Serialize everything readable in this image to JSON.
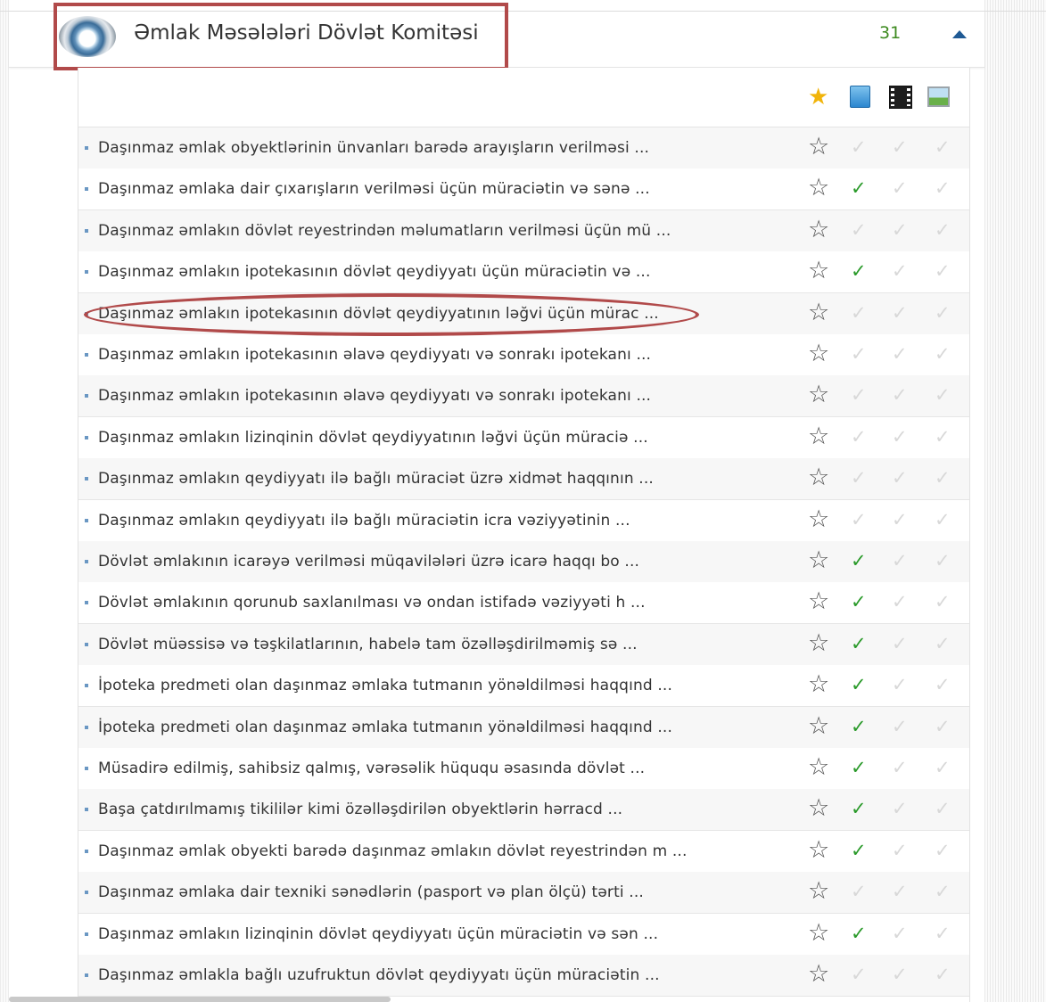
{
  "header": {
    "title": "Əmlak Məsələləri Dövlət Komitəsi",
    "count": "31"
  },
  "columns": [
    {
      "icon": "star-filled-icon"
    },
    {
      "icon": "book-icon"
    },
    {
      "icon": "film-icon"
    },
    {
      "icon": "image-icon"
    }
  ],
  "colors": {
    "accent": "#1f5a94",
    "check_on": "#2a9a2a",
    "highlight": "#b14a4a",
    "count": "#3d8a1f"
  },
  "rows": [
    {
      "label": "Daşınmaz əmlak obyektlərinin ünvanları barədə arayışların verilməsi ...",
      "checks": [
        false,
        false,
        false
      ]
    },
    {
      "label": "Daşınmaz əmlaka dair çıxarışların verilməsi üçün müraciətin və sənə ...",
      "checks": [
        true,
        false,
        false
      ]
    },
    {
      "label": "Daşınmaz əmlakın dövlət reyestrindən məlumatların verilməsi üçün mü ...",
      "checks": [
        false,
        false,
        false
      ]
    },
    {
      "label": "Daşınmaz əmlakın ipotekasının dövlət qeydiyyatı üçün müraciətin və ...",
      "checks": [
        true,
        false,
        false
      ]
    },
    {
      "label": "Daşınmaz əmlakın ipotekasının dövlət qeydiyyatının ləğvi üçün mürac ...",
      "checks": [
        false,
        false,
        false
      ]
    },
    {
      "label": "Daşınmaz əmlakın ipotekasının əlavə qeydiyyatı və sonrakı ipotekanı ...",
      "checks": [
        false,
        false,
        false
      ]
    },
    {
      "label": "Daşınmaz əmlakın ipotekasının əlavə qeydiyyatı və sonrakı ipotekanı ...",
      "checks": [
        false,
        false,
        false
      ]
    },
    {
      "label": "Daşınmaz əmlakın lizinqinin dövlət qeydiyyatının ləğvi üçün müraciə ...",
      "checks": [
        false,
        false,
        false
      ]
    },
    {
      "label": "Daşınmaz əmlakın qeydiyyatı ilə bağlı müraciət üzrə xidmət haqqının ...",
      "checks": [
        false,
        false,
        false
      ]
    },
    {
      "label": "Daşınmaz əmlakın qeydiyyatı ilə bağlı müraciətin icra vəziyyətinin ...",
      "checks": [
        false,
        false,
        false
      ]
    },
    {
      "label": "Dövlət əmlakının icarəyə verilməsi müqavilələri üzrə icarə haqqı bo ...",
      "checks": [
        true,
        false,
        false
      ]
    },
    {
      "label": "Dövlət əmlakının qorunub saxlanılması və ondan istifadə vəziyyəti h ...",
      "checks": [
        true,
        false,
        false
      ]
    },
    {
      "label": "Dövlət müəssisə və təşkilatlarının, habelə tam özəlləşdirilməmiş sə ...",
      "checks": [
        true,
        false,
        false
      ]
    },
    {
      "label": "İpoteka predmeti olan daşınmaz əmlaka tutmanın yönəldilməsi haqqınd ...",
      "checks": [
        true,
        false,
        false
      ]
    },
    {
      "label": "İpoteka predmeti olan daşınmaz əmlaka tutmanın yönəldilməsi haqqınd ...",
      "checks": [
        true,
        false,
        false
      ]
    },
    {
      "label": "Müsadirə edilmiş, sahibsiz qalmış, vərəsəlik hüququ əsasında dövlət ...",
      "checks": [
        true,
        false,
        false
      ]
    },
    {
      "label": "Başa çatdırılmamış tikililər kimi özəlləşdirilən obyektlərin hərracd ...",
      "checks": [
        true,
        false,
        false
      ]
    },
    {
      "label": "Daşınmaz əmlak obyekti barədə daşınmaz əmlakın dövlət reyestrindən m ...",
      "checks": [
        true,
        false,
        false
      ]
    },
    {
      "label": "Daşınmaz əmlaka dair texniki sənədlərin (pasport və plan ölçü) tərti ...",
      "checks": [
        false,
        false,
        false
      ]
    },
    {
      "label": "Daşınmaz əmlakın lizinqinin dövlət qeydiyyatı üçün müraciətin və sən ...",
      "checks": [
        true,
        false,
        false
      ]
    },
    {
      "label": "Daşınmaz əmlakla bağlı uzufruktun dövlət qeydiyyatı üçün müraciətin ...",
      "checks": [
        false,
        false,
        false
      ]
    }
  ]
}
